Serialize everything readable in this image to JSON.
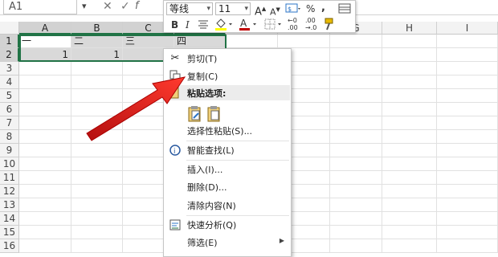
{
  "formula_bar": {
    "namebox": "A1",
    "cancel": "✕",
    "confirm": "✓",
    "fx": "f"
  },
  "columns": [
    "A",
    "B",
    "C",
    "D",
    "E",
    "F",
    "G",
    "H",
    "I"
  ],
  "rows": [
    "1",
    "2",
    "3",
    "4",
    "5",
    "6",
    "7",
    "8",
    "9",
    "10",
    "11",
    "12",
    "13",
    "14",
    "15",
    "16"
  ],
  "cells": {
    "a1": "一",
    "b1": "二",
    "c1": "三",
    "d1": "四",
    "a2": "1",
    "b2": "1"
  },
  "mini_toolbar": {
    "font_name": "等线",
    "font_size": "11",
    "increase_font": "A",
    "decrease_font": "A",
    "percent": "%",
    "comma": ",",
    "bold": "B",
    "italic": "I",
    "font_color_letter": "A",
    "dec_inc": ".0",
    "dec_dec": ".00",
    "accent_color": "#c00000"
  },
  "context_menu": {
    "cut": "剪切(T)",
    "copy": "复制(C)",
    "paste_options_header": "粘贴选项:",
    "paste_special": "选择性粘贴(S)...",
    "smart_lookup": "智能查找(L)",
    "insert": "插入(I)...",
    "delete": "删除(D)...",
    "clear_contents": "清除内容(N)",
    "quick_analysis": "快速分析(Q)",
    "filter": "筛选(E)"
  },
  "colors": {
    "selection_border": "#217346",
    "arrow": "#e52420"
  }
}
